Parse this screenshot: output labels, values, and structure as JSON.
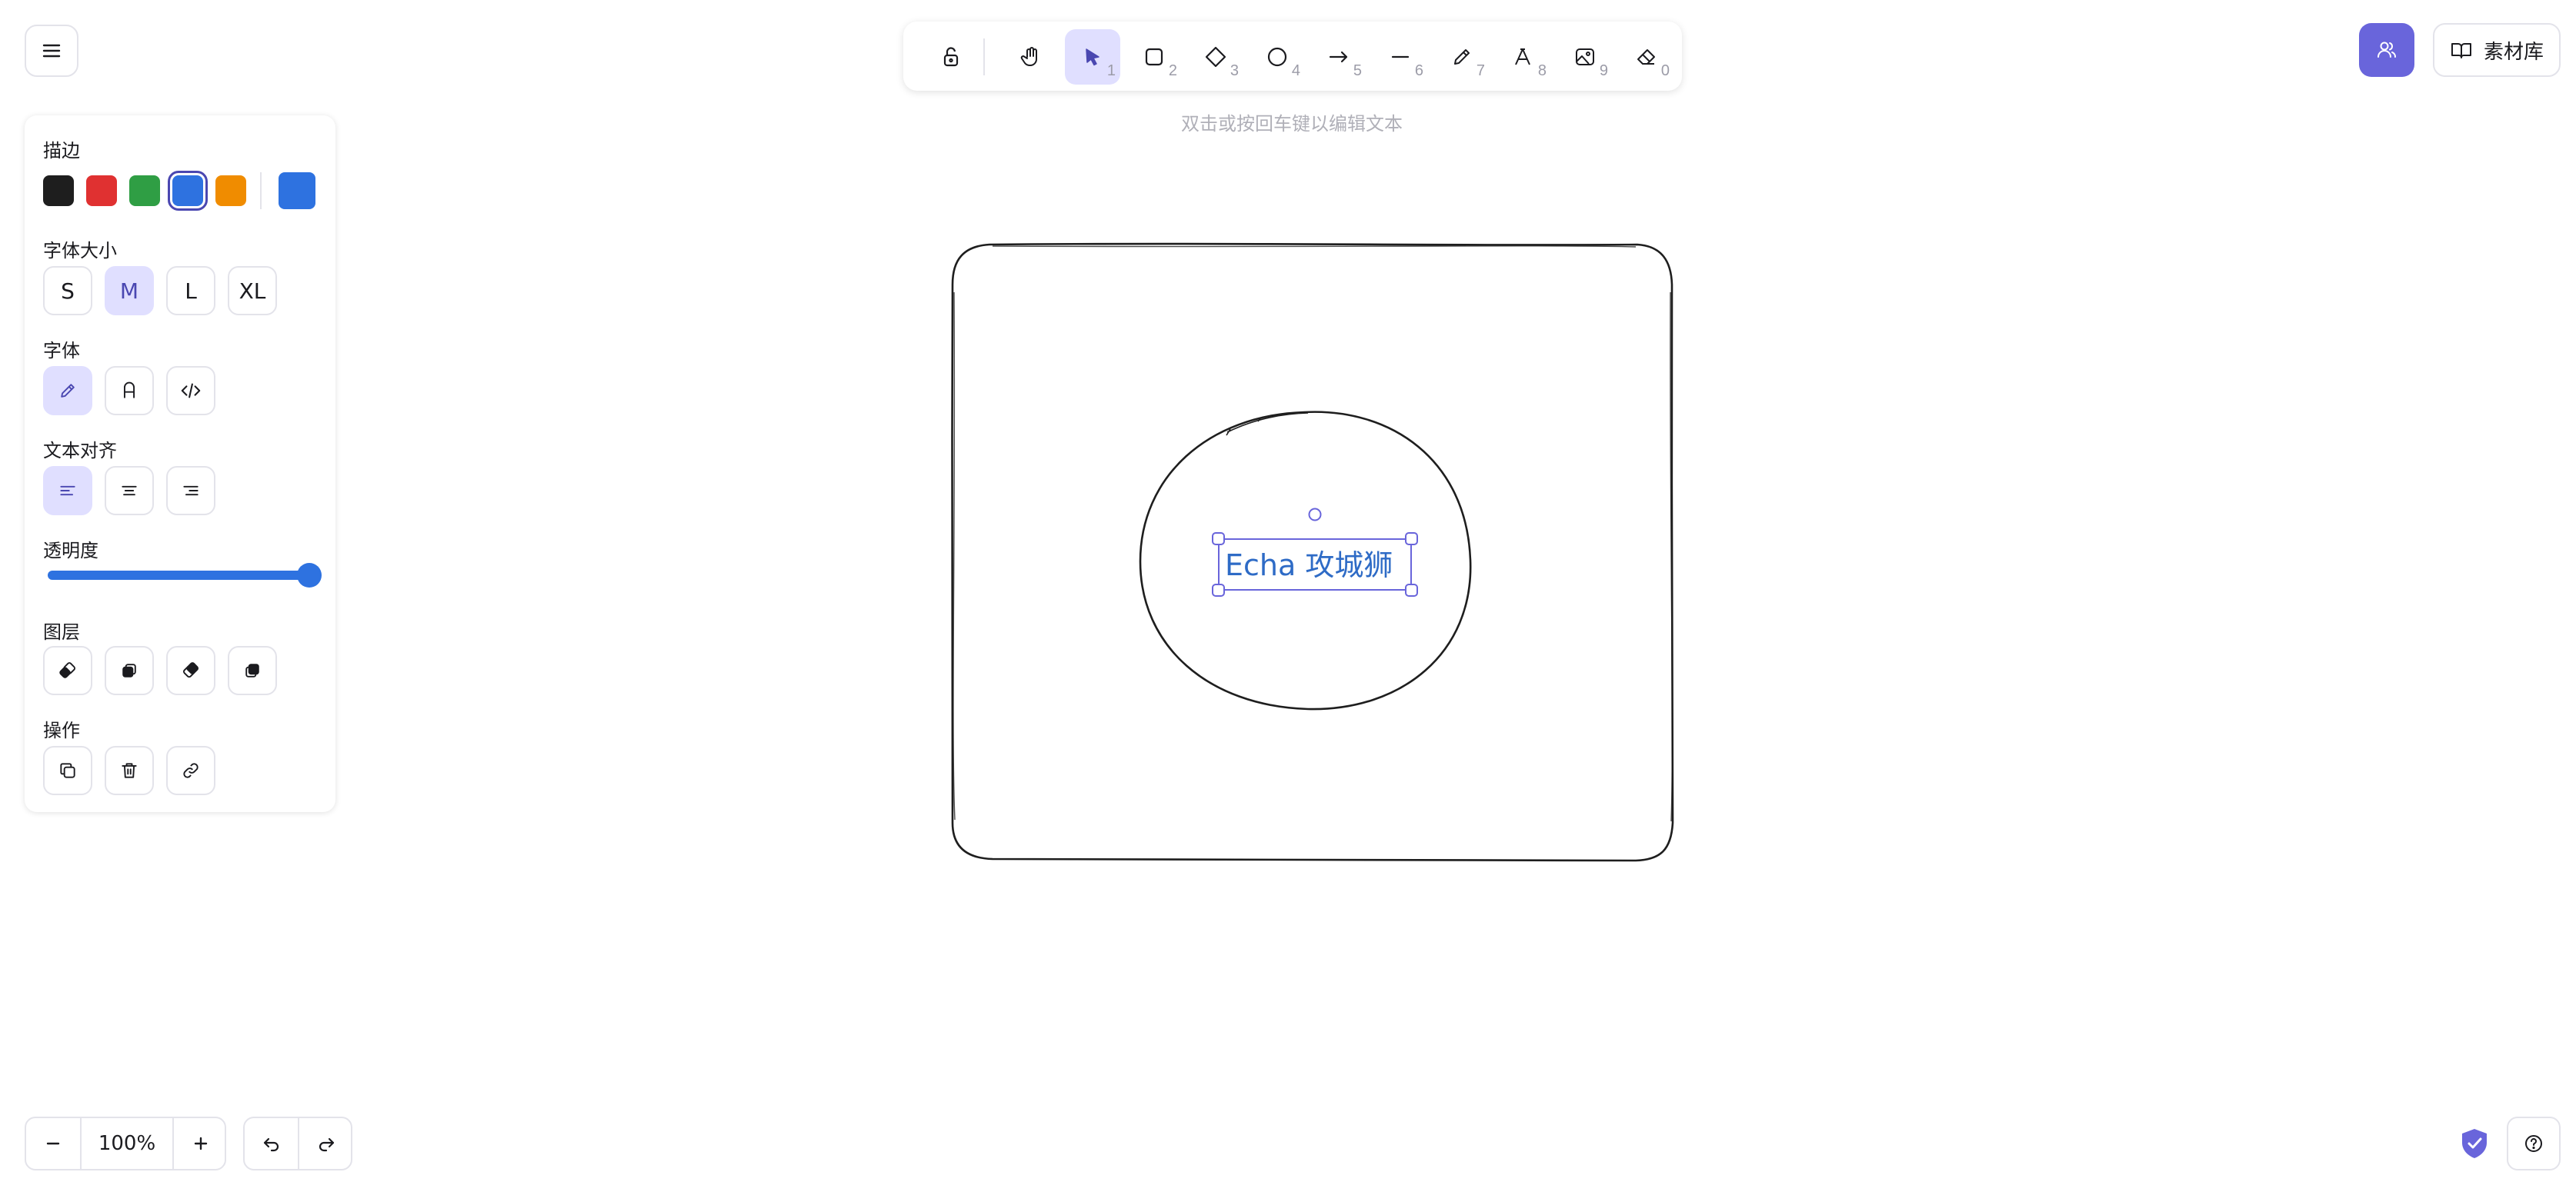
{
  "app": {
    "hint": "双击或按回车键以编辑文本",
    "library_label": "素材库"
  },
  "toolbar": {
    "tools": [
      {
        "icon": "lock-open-icon",
        "num": ""
      },
      {
        "icon": "hand-icon",
        "num": ""
      },
      {
        "icon": "selection-arrow-icon",
        "num": "1"
      },
      {
        "icon": "rectangle-icon",
        "num": "2"
      },
      {
        "icon": "diamond-icon",
        "num": "3"
      },
      {
        "icon": "ellipse-icon",
        "num": "4"
      },
      {
        "icon": "arrow-icon",
        "num": "5"
      },
      {
        "icon": "line-icon",
        "num": "6"
      },
      {
        "icon": "pencil-icon",
        "num": "7"
      },
      {
        "icon": "text-icon",
        "num": "8"
      },
      {
        "icon": "image-icon",
        "num": "9"
      },
      {
        "icon": "eraser-icon",
        "num": "0"
      }
    ]
  },
  "panel": {
    "stroke_title": "描边",
    "stroke_colors": [
      "#1e1e1e",
      "#e03131",
      "#2f9e44",
      "#2e72e0",
      "#f08c00"
    ],
    "selected_color": "#2e72e0",
    "font_size_title": "字体大小",
    "font_sizes": [
      "S",
      "M",
      "L",
      "XL"
    ],
    "font_family_title": "字体",
    "text_align_title": "文本对齐",
    "opacity_title": "透明度",
    "opacity_value": 100,
    "layer_title": "图层",
    "actions_title": "操作"
  },
  "canvas": {
    "text": "Echa 攻城狮"
  },
  "footer": {
    "zoom": "100%"
  }
}
